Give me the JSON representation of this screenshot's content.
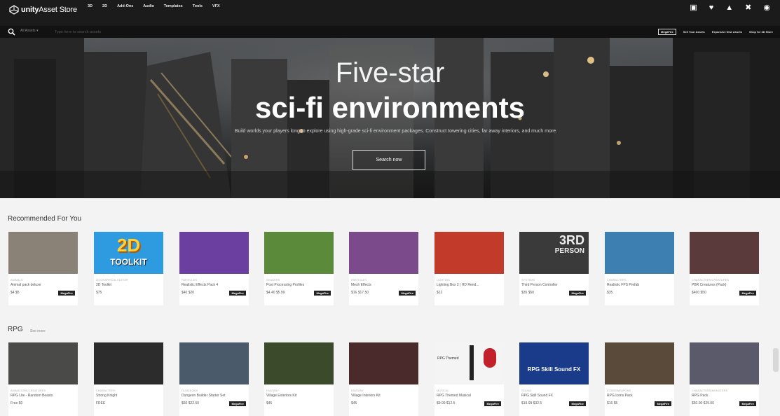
{
  "header": {
    "brand_strong": "unity",
    "brand_rest": "Asset Store",
    "nav": [
      "3D",
      "2D",
      "Add-Ons",
      "Audio",
      "Templates",
      "Tools",
      "VFX"
    ],
    "icons": [
      "grid-icon",
      "heart-icon",
      "bell-icon",
      "cart-icon",
      "user-icon"
    ]
  },
  "search": {
    "scope": "All Assets ▾",
    "placeholder": "Type here to search assets",
    "promo_pill": "MegaFire",
    "links": [
      "Sell Your Assets",
      "Expansive New Assets",
      "Shop for 3D Store"
    ]
  },
  "hero": {
    "title1": "Five-star",
    "title2": "sci-fi environments",
    "description": "Build worlds your players long to explore using high-grade sci-fi environment packages. Construct towering cities, far away interiors, and much more.",
    "button": "Search now"
  },
  "recommended": {
    "title": "Recommended For You",
    "items": [
      {
        "cat": "ANIMALS",
        "name": "Animal pack deluxe",
        "price": "$4  $5",
        "badge": "MegaFire",
        "thumb": "#8a8276"
      },
      {
        "cat": "2D/GRAPHICAL EDITOR",
        "name": "2D Toolkit",
        "price": "$75",
        "badge": "",
        "thumb": "#2e9be0"
      },
      {
        "cat": "PARTICLES",
        "name": "Realistic Effects Pack 4",
        "price": "$40  $20",
        "badge": "MegaFire",
        "thumb": "#6b3fa0"
      },
      {
        "cat": "SHADERS",
        "name": "Post Processing Profiles",
        "price": "$4.40  $5.99",
        "badge": "MegaFire",
        "thumb": "#5b8a3a"
      },
      {
        "cat": "PARTICLES",
        "name": "Mesh Effects",
        "price": "$16  $17.50",
        "badge": "MegaFire",
        "thumb": "#7a4a8a"
      },
      {
        "cat": "LIGHTING",
        "name": "Lighting Box 2 | HD Rend...",
        "price": "$12",
        "badge": "",
        "thumb": "#c23a2a"
      },
      {
        "cat": "SYSTEMS",
        "name": "Third Person Controller",
        "price": "$35  $50",
        "badge": "MegaFire",
        "thumb": "#3a3a3a"
      },
      {
        "cat": "CHARACTERS",
        "name": "Realistic FPS Prefab",
        "price": "$35",
        "badge": "",
        "thumb": "#3c7fb0"
      },
      {
        "cat": "CHARACTERS/CREATURES",
        "name": "PBR Creatures (Pack)",
        "price": "$400  $50",
        "badge": "MegaFire",
        "thumb": "#5a3a3a"
      }
    ]
  },
  "rpg": {
    "title": "RPG",
    "see_more": "See more",
    "items": [
      {
        "cat": "ANIMATIONS/CREATURES",
        "name": "RPG Lite - Random Beasts",
        "price": "Free  $0",
        "badge": "",
        "thumb": "#4a4a48"
      },
      {
        "cat": "CHARACTERS",
        "name": "Strong Knight",
        "price": "FREE",
        "badge": "",
        "thumb": "#2c2c2c"
      },
      {
        "cat": "DUNGEONS",
        "name": "Dungeon Builder Starter Set",
        "price": "$60  $22.50",
        "badge": "MegaFire",
        "thumb": "#4a5a6a"
      },
      {
        "cat": "FANTASY",
        "name": "Village Exteriors Kit",
        "price": "$45",
        "badge": "",
        "thumb": "#3a4a2a"
      },
      {
        "cat": "FANTASY",
        "name": "Village Interiors Kit",
        "price": "$45",
        "badge": "",
        "thumb": "#4a2a2a"
      },
      {
        "cat": "MUSICAL",
        "name": "RPG Themed Musical",
        "price": "$9.99  $12.5",
        "badge": "MegaFire",
        "thumb": "#f4f4f4"
      },
      {
        "cat": "SOUND",
        "name": "RPG Skill Sound FX",
        "price": "$19.99  $32.5",
        "badge": "MegaFire",
        "thumb": "#1a3a8a"
      },
      {
        "cat": "ICONS/WEAPONS",
        "name": "RPG Icons Pack",
        "price": "$16  $5",
        "badge": "MegaFire",
        "thumb": "#5a4a3a"
      },
      {
        "cat": "CHARACTERS/MONSTERS",
        "name": "RPG Pack",
        "price": "$50.00  $25.00",
        "badge": "MegaFire",
        "thumb": "#5a5a6a"
      }
    ]
  },
  "thumb_text": {
    "toolkit_top": "2D",
    "toolkit_bottom": "TOOLKIT",
    "third_person": "3RD",
    "third_person2": "PERSON",
    "skill_fx": "RPG Skill Sound FX",
    "rpg_music": "RPG Themed"
  }
}
